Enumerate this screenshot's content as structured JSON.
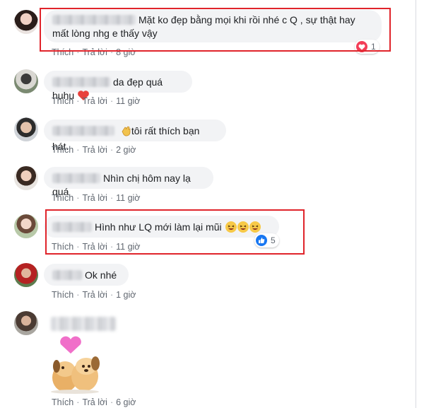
{
  "comments": [
    {
      "text_line1": "Mặt ko đẹp bằng mọi khi rồi nhé c Q , sự thật hay",
      "text_line2": "mất lòng nhg e thấy vậy",
      "like": "Thích",
      "reply": "Trả lời",
      "time": "8 giờ",
      "reaction": {
        "type": "love",
        "icon": "heart-icon",
        "count": "1"
      }
    },
    {
      "text": "da đẹp quá huhu",
      "emoji": "red-heart-icon",
      "like": "Thích",
      "reply": "Trả lời",
      "time": "11 giờ"
    },
    {
      "text": "tôi rất thích bạn hát.",
      "emoji": "clapping-hands-icon",
      "like": "Thích",
      "reply": "Trả lời",
      "time": "2 giờ"
    },
    {
      "text": "Nhìn chị hôm nay lạ quá",
      "like": "Thích",
      "reply": "Trả lời",
      "time": "11 giờ"
    },
    {
      "text": "Hình như LQ mới làm lại mũi",
      "emoji": "squinting-laugh-icon",
      "like": "Thích",
      "reply": "Trả lời",
      "time": "11 giờ",
      "reaction": {
        "type": "like",
        "icon": "thumbs-up-icon",
        "count": "5"
      }
    },
    {
      "text": "Ok nhé",
      "like": "Thích",
      "reply": "Trả lời",
      "time": "1 giờ"
    },
    {
      "sticker": "puppies-heart-sticker",
      "like": "Thích",
      "reply": "Trả lời",
      "time": "6 giờ"
    }
  ],
  "colors": {
    "highlight": "#e0242b",
    "bubble": "#f2f3f5",
    "like_blue": "#1877f2",
    "love_red": "#f33e58"
  }
}
